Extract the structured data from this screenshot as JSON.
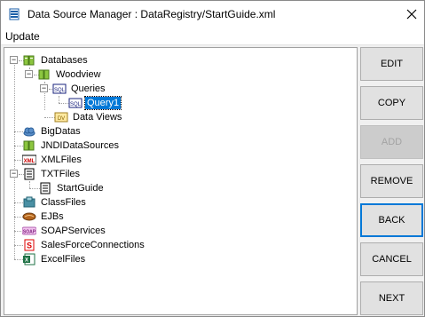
{
  "window": {
    "title": "Data Source Manager : DataRegistry/StartGuide.xml",
    "close_glyph": "✕"
  },
  "menu": {
    "items": [
      "Update"
    ]
  },
  "tree": {
    "databases": "Databases",
    "woodview": "Woodview",
    "queries": "Queries",
    "query1": "Query1",
    "data_views": "Data Views",
    "bigdatas": "BigDatas",
    "jndi": "JNDIDataSources",
    "xmlfiles": "XMLFiles",
    "txtfiles": "TXTFiles",
    "startguide": "StartGuide",
    "classfiles": "ClassFiles",
    "ejbs": "EJBs",
    "soap": "SOAPServices",
    "salesforce": "SalesForceConnections",
    "excel": "ExcelFiles",
    "icon_text": {
      "sql": "SQL",
      "dv": "DV",
      "xml": "XML",
      "soap": "SOAP",
      "s": "S",
      "x": "X"
    }
  },
  "buttons": {
    "edit": "EDIT",
    "copy": "COPY",
    "add": "ADD",
    "remove": "REMOVE",
    "back": "BACK",
    "cancel": "CANCEL",
    "next": "NEXT"
  }
}
